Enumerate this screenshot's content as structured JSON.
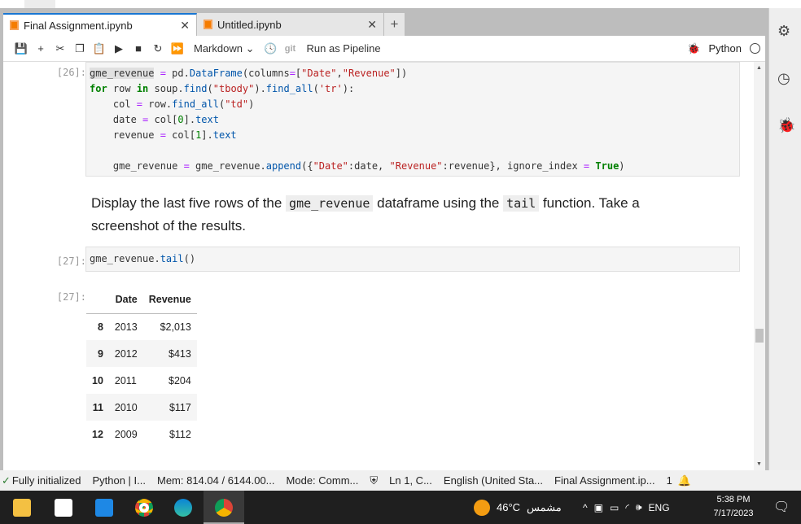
{
  "tabs": [
    {
      "label": "Final Assignment.ipynb",
      "active": true
    },
    {
      "label": "Untitled.ipynb",
      "active": false
    }
  ],
  "toolbar": {
    "cell_type": "Markdown",
    "git": "git",
    "run_pipeline": "Run as Pipeline",
    "kernel": "Python"
  },
  "cells": [
    {
      "prompt": "[26]:",
      "lines": [
        [
          [
            "hl v",
            "gme_revenue"
          ],
          [
            "o",
            " = "
          ],
          [
            "v",
            "pd."
          ],
          [
            "n",
            "DataFrame"
          ],
          [
            "v",
            "(columns"
          ],
          [
            "o",
            "="
          ],
          [
            "v",
            "["
          ],
          [
            "s",
            "\"Date\""
          ],
          [
            "v",
            ","
          ],
          [
            "s",
            "\"Revenue\""
          ],
          [
            "v",
            "])"
          ]
        ],
        [
          [
            "k",
            "for"
          ],
          [
            "v",
            " row "
          ],
          [
            "k",
            "in"
          ],
          [
            "v",
            " soup."
          ],
          [
            "n",
            "find"
          ],
          [
            "v",
            "("
          ],
          [
            "s",
            "\"tbody\""
          ],
          [
            "v",
            ")."
          ],
          [
            "n",
            "find_all"
          ],
          [
            "v",
            "("
          ],
          [
            "s",
            "'tr'"
          ],
          [
            "v",
            "):"
          ]
        ],
        [
          [
            "v",
            "    col "
          ],
          [
            "o",
            "="
          ],
          [
            "v",
            " row."
          ],
          [
            "n",
            "find_all"
          ],
          [
            "v",
            "("
          ],
          [
            "s",
            "\"td\""
          ],
          [
            "v",
            ")"
          ]
        ],
        [
          [
            "v",
            "    date "
          ],
          [
            "o",
            "="
          ],
          [
            "v",
            " col["
          ],
          [
            "m",
            "0"
          ],
          [
            "v",
            "]."
          ],
          [
            "n",
            "text"
          ]
        ],
        [
          [
            "v",
            "    revenue "
          ],
          [
            "o",
            "="
          ],
          [
            "v",
            " col["
          ],
          [
            "m",
            "1"
          ],
          [
            "v",
            "]."
          ],
          [
            "n",
            "text"
          ]
        ],
        [],
        [
          [
            "v",
            "    gme_revenue "
          ],
          [
            "o",
            "="
          ],
          [
            "v",
            " gme_revenue."
          ],
          [
            "n",
            "append"
          ],
          [
            "v",
            "({"
          ],
          [
            "s",
            "\"Date\""
          ],
          [
            "v",
            ":date, "
          ],
          [
            "s",
            "\"Revenue\""
          ],
          [
            "v",
            ":revenue}, ignore_index "
          ],
          [
            "o",
            "="
          ],
          [
            "v",
            " "
          ],
          [
            "k",
            "True"
          ],
          [
            "v",
            ")"
          ]
        ]
      ]
    },
    {
      "prompt": "[27]:",
      "lines": [
        [
          [
            "v",
            "gme_revenue."
          ],
          [
            "n",
            "tail"
          ],
          [
            "v",
            "()"
          ]
        ]
      ]
    }
  ],
  "markdown": {
    "t1": "Display the last five rows of the ",
    "c1": "gme_revenue",
    "t2": " dataframe using the ",
    "c2": "tail",
    "t3": " function. Take a screenshot of the results."
  },
  "output": {
    "prompt": "[27]:",
    "headers": [
      "",
      "Date",
      "Revenue"
    ],
    "rows": [
      [
        "8",
        "2013",
        "$2,013"
      ],
      [
        "9",
        "2012",
        "$413"
      ],
      [
        "10",
        "2011",
        "$204"
      ],
      [
        "11",
        "2010",
        "$117"
      ],
      [
        "12",
        "2009",
        "$112"
      ]
    ]
  },
  "status": {
    "init": "Fully initialized",
    "kernel": "Python | I...",
    "mem": "Mem: 814.04 / 6144.00...",
    "mode": "Mode: Comm...",
    "pos": "Ln 1, C...",
    "lang": "English (United Sta...",
    "file": "Final Assignment.ip...",
    "count": "1"
  },
  "taskbar": {
    "weather": "46°C",
    "weather_desc": "مشمس",
    "lang": "ENG",
    "time": "5:38 PM",
    "date": "7/17/2023"
  }
}
